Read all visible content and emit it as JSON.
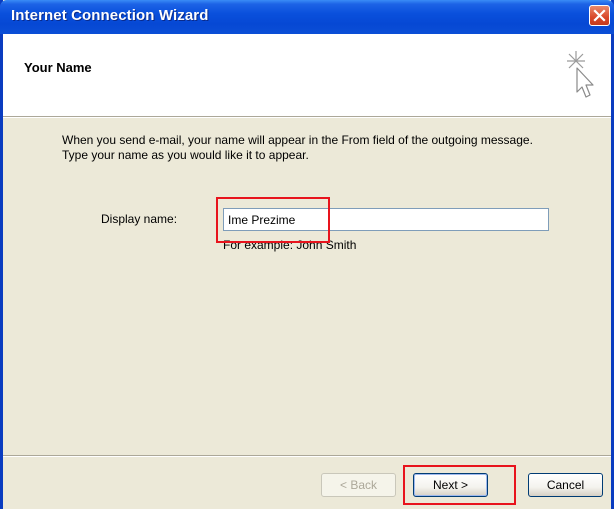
{
  "window": {
    "title": "Internet Connection Wizard"
  },
  "header": {
    "title": "Your Name",
    "icon": "wizard-cursor-sparkle-icon"
  },
  "intro": {
    "line1": "When you send e-mail, your name will appear in the From field of the outgoing message.",
    "line2": "Type your name as you would like it to appear."
  },
  "form": {
    "display_name_label": "Display name:",
    "display_name_value": "Ime Prezime",
    "example_text": "For example: John Smith"
  },
  "buttons": {
    "back_label": "< Back",
    "next_label": "Next >",
    "cancel_label": "Cancel"
  },
  "colors": {
    "titlebar": "#0a50dc",
    "dialog_bg": "#ece9d8",
    "highlight": "#e8141d"
  }
}
